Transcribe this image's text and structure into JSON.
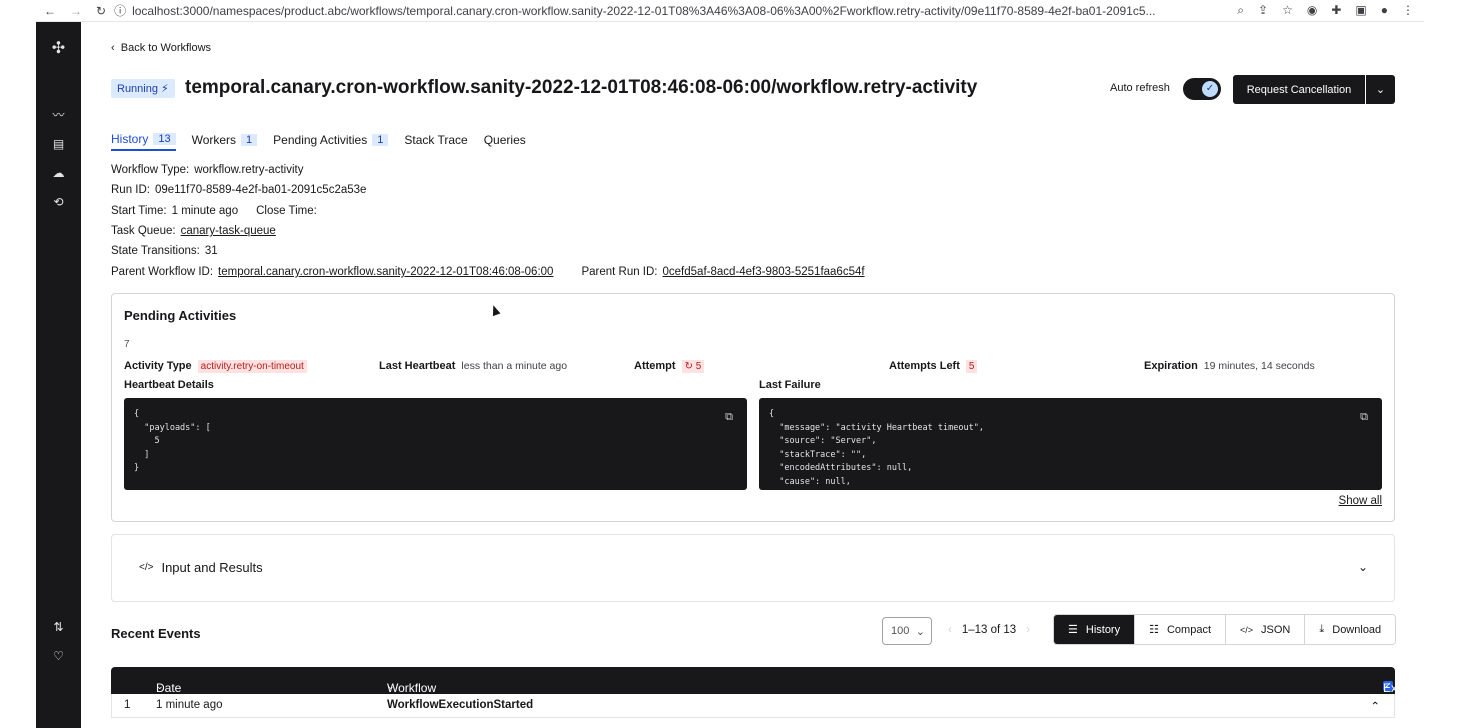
{
  "browser": {
    "url": "localhost:3000/namespaces/product.abc/workflows/temporal.canary.cron-workflow.sanity-2022-12-01T08%3A46%3A08-06%3A00%2Fworkflow.retry-activity/09e11f70-8589-4e2f-ba01-2091c5...",
    "back_icon": "arrow-left-icon",
    "forward_icon": "arrow-right-icon",
    "reload_icon": "reload-icon"
  },
  "header": {
    "back_link": "Back to Workflows",
    "status": "Running",
    "title": "temporal.canary.cron-workflow.sanity-2022-12-01T08:46:08-06:00/workflow.retry-activity",
    "auto_refresh_label": "Auto refresh",
    "auto_refresh_on": true,
    "cancel_button": "Request Cancellation"
  },
  "tabs": [
    {
      "label": "History",
      "count": "13"
    },
    {
      "label": "Workers",
      "count": "1"
    },
    {
      "label": "Pending Activities",
      "count": "1"
    },
    {
      "label": "Stack Trace",
      "count": ""
    },
    {
      "label": "Queries",
      "count": ""
    }
  ],
  "details": {
    "workflow_type_k": "Workflow Type:",
    "workflow_type_v": "workflow.retry-activity",
    "run_id_k": "Run ID:",
    "run_id_v": "09e11f70-8589-4e2f-ba01-2091c5c2a53e",
    "start_time_k": "Start Time:",
    "start_time_v": "1 minute ago",
    "close_time_k": "Close Time:",
    "task_queue_k": "Task Queue:",
    "task_queue_v": "canary-task-queue",
    "state_transitions_k": "State Transitions:",
    "state_transitions_v": "31",
    "parent_workflow_k": "Parent Workflow ID:",
    "parent_workflow_v": "temporal.canary.cron-workflow.sanity-2022-12-01T08:46:08-06:00",
    "parent_run_k": "Parent Run ID:",
    "parent_run_v": "0cefd5af-8acd-4ef3-9803-5251faa6c54f"
  },
  "pending": {
    "title": "Pending Activities",
    "number": "7",
    "activity_type_k": "Activity Type",
    "activity_type_v": "activity.retry-on-timeout",
    "last_heartbeat_k": "Last Heartbeat",
    "last_heartbeat_v": "less than a minute ago",
    "attempt_k": "Attempt",
    "attempt_v": "5",
    "attempts_left_k": "Attempts Left",
    "attempts_left_v": "5",
    "expiration_k": "Expiration",
    "expiration_v": "19 minutes, 14 seconds",
    "heartbeat_details_k": "Heartbeat Details",
    "heartbeat_code": "{\n  \"payloads\": [\n    5\n  ]\n}",
    "last_failure_k": "Last Failure",
    "failure_code": "{\n  \"message\": \"activity Heartbeat timeout\",\n  \"source\": \"Server\",\n  \"stackTrace\": \"\",\n  \"encodedAttributes\": null,\n  \"cause\": null,",
    "show_all": "Show all"
  },
  "input_results": {
    "label": "Input and Results"
  },
  "recent": {
    "title": "Recent Events",
    "per_page": "100",
    "range": "1–13 of 13",
    "views": [
      "History",
      "Compact",
      "JSON",
      "Download"
    ],
    "columns": {
      "date": "Date & Time",
      "events": "Workflow Events",
      "expand_all": "Expand all"
    },
    "rows": [
      {
        "index": "1",
        "time": "1 minute ago",
        "event": "WorkflowExecutionStarted"
      }
    ]
  }
}
